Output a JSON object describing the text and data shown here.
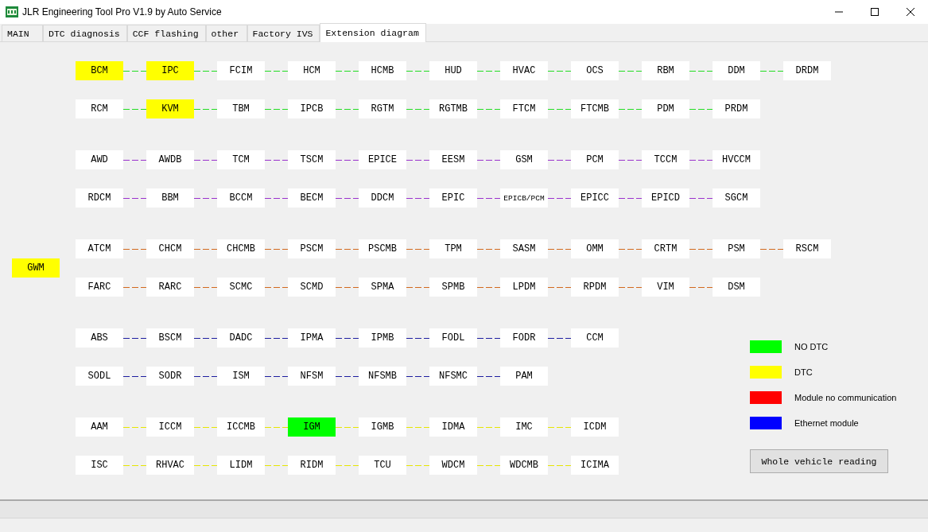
{
  "window": {
    "title": "JLR Engineering Tool Pro V1.9 by Auto Service"
  },
  "tabs": [
    {
      "label": "MAIN",
      "selected": false
    },
    {
      "label": "DTC diagnosis",
      "selected": false
    },
    {
      "label": "CCF flashing",
      "selected": false
    },
    {
      "label": "other",
      "selected": false
    },
    {
      "label": "Factory IVS",
      "selected": false
    },
    {
      "label": "Extension diagram",
      "selected": true
    }
  ],
  "gateway": {
    "name": "GWM",
    "color": "#ffff00"
  },
  "groups": [
    {
      "color": "#22dd22",
      "rows": [
        {
          "modules": [
            {
              "name": "BCM",
              "color": "#ffff00"
            },
            {
              "name": "IPC",
              "color": "#ffff00"
            },
            {
              "name": "FCIM",
              "color": "#ffffff"
            },
            {
              "name": "HCM",
              "color": "#ffffff"
            },
            {
              "name": "HCMB",
              "color": "#ffffff"
            },
            {
              "name": "HUD",
              "color": "#ffffff"
            },
            {
              "name": "HVAC",
              "color": "#ffffff"
            },
            {
              "name": "OCS",
              "color": "#ffffff"
            },
            {
              "name": "RBM",
              "color": "#ffffff"
            },
            {
              "name": "DDM",
              "color": "#ffffff"
            },
            {
              "name": "DRDM",
              "color": "#ffffff"
            }
          ]
        },
        {
          "modules": [
            {
              "name": "RCM",
              "color": "#ffffff"
            },
            {
              "name": "KVM",
              "color": "#ffff00"
            },
            {
              "name": "TBM",
              "color": "#ffffff"
            },
            {
              "name": "IPCB",
              "color": "#ffffff"
            },
            {
              "name": "RGTM",
              "color": "#ffffff"
            },
            {
              "name": "RGTMB",
              "color": "#ffffff"
            },
            {
              "name": "FTCM",
              "color": "#ffffff"
            },
            {
              "name": "FTCMB",
              "color": "#ffffff"
            },
            {
              "name": "PDM",
              "color": "#ffffff"
            },
            {
              "name": "PRDM",
              "color": "#ffffff"
            }
          ]
        }
      ]
    },
    {
      "color": "#9a32cd",
      "rows": [
        {
          "modules": [
            {
              "name": "AWD",
              "color": "#ffffff"
            },
            {
              "name": "AWDB",
              "color": "#ffffff"
            },
            {
              "name": "TCM",
              "color": "#ffffff"
            },
            {
              "name": "TSCM",
              "color": "#ffffff"
            },
            {
              "name": "EPICE",
              "color": "#ffffff"
            },
            {
              "name": "EESM",
              "color": "#ffffff"
            },
            {
              "name": "GSM",
              "color": "#ffffff"
            },
            {
              "name": "PCM",
              "color": "#ffffff"
            },
            {
              "name": "TCCM",
              "color": "#ffffff"
            },
            {
              "name": "HVCCM",
              "color": "#ffffff"
            }
          ]
        },
        {
          "modules": [
            {
              "name": "RDCM",
              "color": "#ffffff"
            },
            {
              "name": "BBM",
              "color": "#ffffff"
            },
            {
              "name": "BCCM",
              "color": "#ffffff"
            },
            {
              "name": "BECM",
              "color": "#ffffff"
            },
            {
              "name": "DDCM",
              "color": "#ffffff"
            },
            {
              "name": "EPIC",
              "color": "#ffffff"
            },
            {
              "name": "EPICB/PCM",
              "color": "#ffffff"
            },
            {
              "name": "EPICC",
              "color": "#ffffff"
            },
            {
              "name": "EPICD",
              "color": "#ffffff"
            },
            {
              "name": "SGCM",
              "color": "#ffffff"
            }
          ]
        }
      ]
    },
    {
      "color": "#d2691e",
      "rows": [
        {
          "modules": [
            {
              "name": "ATCM",
              "color": "#ffffff"
            },
            {
              "name": "CHCM",
              "color": "#ffffff"
            },
            {
              "name": "CHCMB",
              "color": "#ffffff"
            },
            {
              "name": "PSCM",
              "color": "#ffffff"
            },
            {
              "name": "PSCMB",
              "color": "#ffffff"
            },
            {
              "name": "TPM",
              "color": "#ffffff"
            },
            {
              "name": "SASM",
              "color": "#ffffff"
            },
            {
              "name": "OMM",
              "color": "#ffffff"
            },
            {
              "name": "CRTM",
              "color": "#ffffff"
            },
            {
              "name": "PSM",
              "color": "#ffffff"
            },
            {
              "name": "RSCM",
              "color": "#ffffff"
            }
          ]
        },
        {
          "modules": [
            {
              "name": "FARC",
              "color": "#ffffff"
            },
            {
              "name": "RARC",
              "color": "#ffffff"
            },
            {
              "name": "SCMC",
              "color": "#ffffff"
            },
            {
              "name": "SCMD",
              "color": "#ffffff"
            },
            {
              "name": "SPMA",
              "color": "#ffffff"
            },
            {
              "name": "SPMB",
              "color": "#ffffff"
            },
            {
              "name": "LPDM",
              "color": "#ffffff"
            },
            {
              "name": "RPDM",
              "color": "#ffffff"
            },
            {
              "name": "VIM",
              "color": "#ffffff"
            },
            {
              "name": "DSM",
              "color": "#ffffff"
            }
          ]
        }
      ]
    },
    {
      "color": "#1e1ea0",
      "rows": [
        {
          "modules": [
            {
              "name": "ABS",
              "color": "#ffffff"
            },
            {
              "name": "BSCM",
              "color": "#ffffff"
            },
            {
              "name": "DADC",
              "color": "#ffffff"
            },
            {
              "name": "IPMA",
              "color": "#ffffff"
            },
            {
              "name": "IPMB",
              "color": "#ffffff"
            },
            {
              "name": "FODL",
              "color": "#ffffff"
            },
            {
              "name": "FODR",
              "color": "#ffffff"
            },
            {
              "name": "CCM",
              "color": "#ffffff"
            }
          ]
        },
        {
          "modules": [
            {
              "name": "SODL",
              "color": "#ffffff"
            },
            {
              "name": "SODR",
              "color": "#ffffff"
            },
            {
              "name": "ISM",
              "color": "#ffffff"
            },
            {
              "name": "NFSM",
              "color": "#ffffff"
            },
            {
              "name": "NFSMB",
              "color": "#ffffff"
            },
            {
              "name": "NFSMC",
              "color": "#ffffff"
            },
            {
              "name": "PAM",
              "color": "#ffffff"
            }
          ]
        }
      ]
    },
    {
      "color": "#e6e600",
      "rows": [
        {
          "modules": [
            {
              "name": "AAM",
              "color": "#ffffff"
            },
            {
              "name": "ICCM",
              "color": "#ffffff"
            },
            {
              "name": "ICCMB",
              "color": "#ffffff"
            },
            {
              "name": "IGM",
              "color": "#00ff00"
            },
            {
              "name": "IGMB",
              "color": "#ffffff"
            },
            {
              "name": "IDMA",
              "color": "#ffffff"
            },
            {
              "name": "IMC",
              "color": "#ffffff"
            },
            {
              "name": "ICDM",
              "color": "#ffffff"
            }
          ]
        },
        {
          "modules": [
            {
              "name": "ISC",
              "color": "#ffffff"
            },
            {
              "name": "RHVAC",
              "color": "#ffffff"
            },
            {
              "name": "LIDM",
              "color": "#ffffff"
            },
            {
              "name": "RIDM",
              "color": "#ffffff"
            },
            {
              "name": "TCU",
              "color": "#ffffff"
            },
            {
              "name": "WDCM",
              "color": "#ffffff"
            },
            {
              "name": "WDCMB",
              "color": "#ffffff"
            },
            {
              "name": "ICIMA",
              "color": "#ffffff"
            }
          ]
        }
      ]
    }
  ],
  "legend": [
    {
      "label": "NO DTC",
      "color": "#00ff00"
    },
    {
      "label": "DTC",
      "color": "#ffff00"
    },
    {
      "label": "Module no communication",
      "color": "#ff0000"
    },
    {
      "label": "Ethernet module",
      "color": "#0000ff"
    }
  ],
  "action_button": {
    "label": "Whole vehicle reading"
  }
}
